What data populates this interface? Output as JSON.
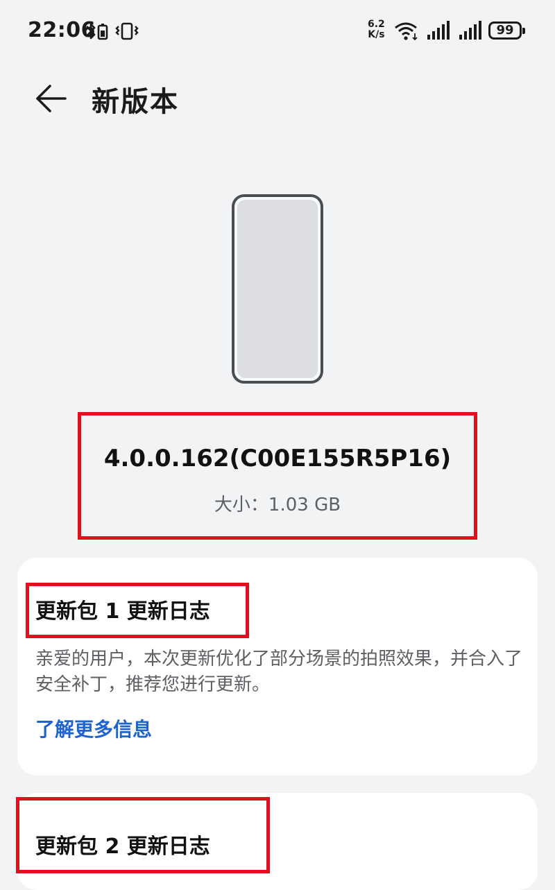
{
  "status_bar": {
    "time": "22:06",
    "net_speed_value": "6.2",
    "net_speed_unit": "K/s",
    "battery": "99",
    "icons": [
      "bluetooth-battery-icon",
      "vibrate-icon",
      "wifi-icon",
      "signal-icon",
      "signal-icon",
      "battery-icon"
    ]
  },
  "header": {
    "title": "新版本"
  },
  "update": {
    "version": "4.0.0.162(C00E155R5P16)",
    "size": "大小：1.03 GB"
  },
  "logs": [
    {
      "title": "更新包 1 更新日志",
      "description": "亲爱的用户，本次更新优化了部分场景的拍照效果，并合入了安全补丁，推荐您进行更新。",
      "link": "了解更多信息"
    },
    {
      "title": "更新包 2 更新日志"
    }
  ],
  "colors": {
    "background": "#f1f3f5",
    "card": "#ffffff",
    "highlight_box": "#e0101e",
    "link": "#1f63cc"
  }
}
